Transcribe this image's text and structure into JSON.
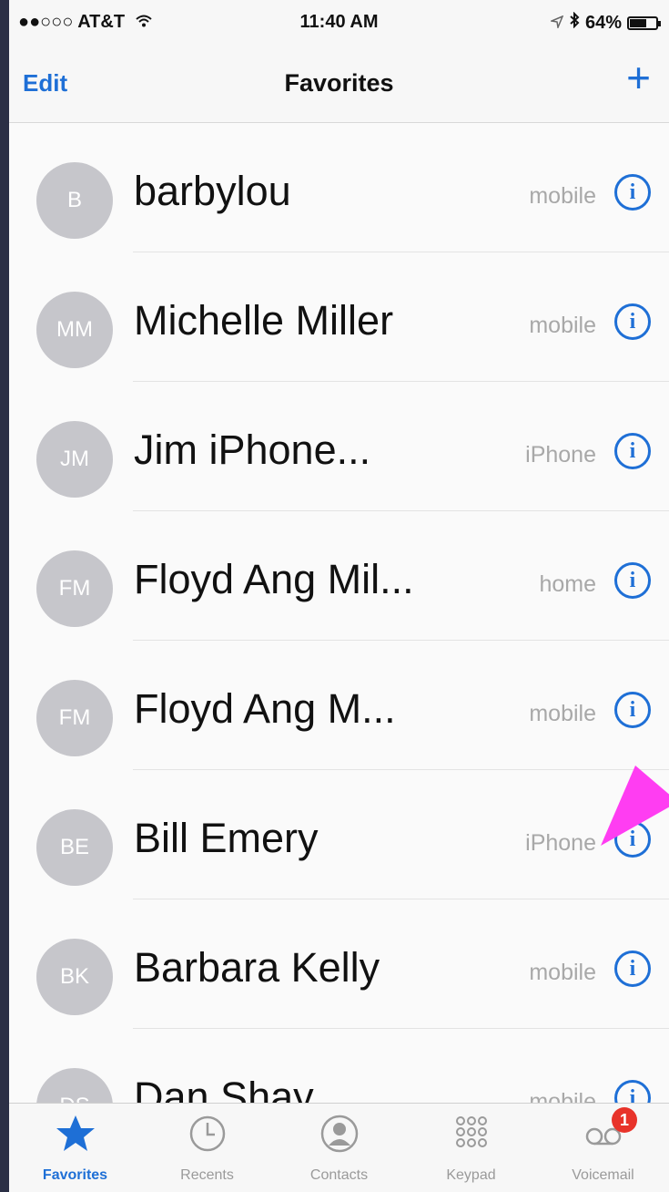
{
  "status_bar": {
    "carrier": "●●○○○ AT&T",
    "time": "11:40 AM",
    "battery": "64%",
    "battery_level": 0.64
  },
  "nav": {
    "edit": "Edit",
    "title": "Favorites",
    "add": "+"
  },
  "favorites": [
    {
      "initials": "B",
      "name": "barbylou",
      "label": "mobile"
    },
    {
      "initials": "MM",
      "name": "Michelle Miller",
      "label": "mobile"
    },
    {
      "initials": "JM",
      "name": "Jim iPhone...",
      "label": "iPhone"
    },
    {
      "initials": "FM",
      "name": "Floyd Ang Mil...",
      "label": "home"
    },
    {
      "initials": "FM",
      "name": "Floyd Ang M...",
      "label": "mobile"
    },
    {
      "initials": "BE",
      "name": "Bill Emery",
      "label": "iPhone"
    },
    {
      "initials": "BK",
      "name": "Barbara Kelly",
      "label": "mobile"
    },
    {
      "initials": "DS",
      "name": "Dan Shay",
      "label": "mobile"
    }
  ],
  "tabs": [
    {
      "label": "Favorites",
      "icon": "star-icon",
      "active": true
    },
    {
      "label": "Recents",
      "icon": "clock-icon",
      "active": false
    },
    {
      "label": "Contacts",
      "icon": "contact-icon",
      "active": false
    },
    {
      "label": "Keypad",
      "icon": "keypad-icon",
      "active": false
    },
    {
      "label": "Voicemail",
      "icon": "voicemail-icon",
      "active": false,
      "badge": "1"
    }
  ],
  "colors": {
    "accent": "#1e6fd6",
    "badge": "#e8332a",
    "annotation_arrow": "#ff3df2"
  }
}
